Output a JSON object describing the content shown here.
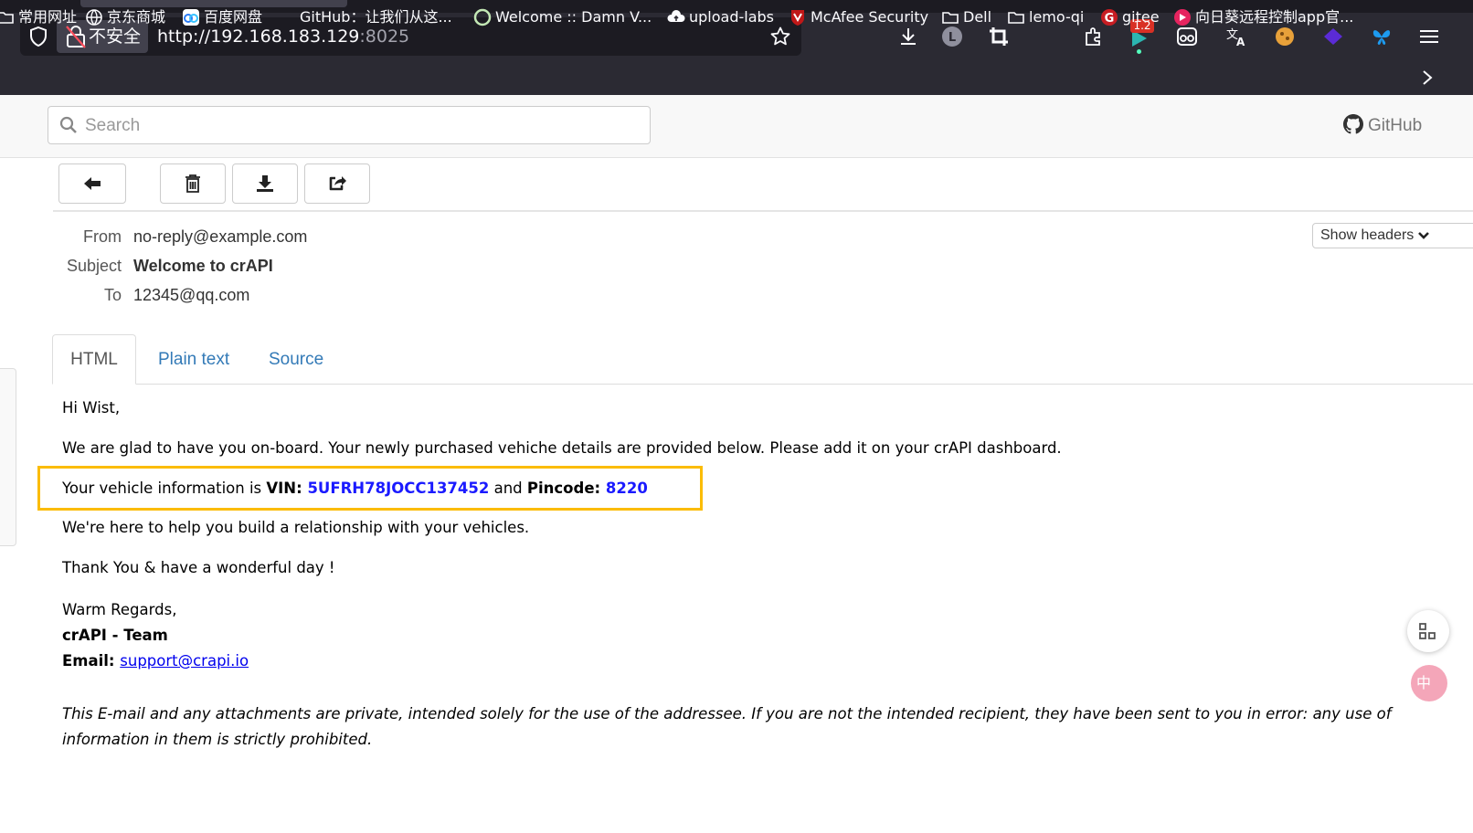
{
  "browser": {
    "security_label": "不安全",
    "url_main": "http://192.168.183.129",
    "url_port": ":8025",
    "badge_count": "1.2",
    "bookmarks": [
      "常用网址",
      "京东商城",
      "百度网盘",
      "GitHub：让我们从这...",
      "Welcome :: Damn V...",
      "upload-labs",
      "McAfee Security",
      "Dell",
      "lemo-qi",
      "gitee",
      "向日葵远程控制app官..."
    ],
    "ime_label": "中"
  },
  "app": {
    "search_placeholder": "Search",
    "github_label": "GitHub"
  },
  "message": {
    "from_label": "From",
    "from": "no-reply@example.com",
    "subject_label": "Subject",
    "subject": "Welcome to crAPI",
    "to_label": "To",
    "to": "12345@qq.com",
    "show_headers": "Show headers",
    "tabs": [
      "HTML",
      "Plain text",
      "Source"
    ]
  },
  "email_body": {
    "greeting": "Hi Wist,",
    "intro": "We are glad to have you on-board. Your newly purchased vehiche details are provided below. Please add it on your crAPI dashboard.",
    "vehicle_prefix": "Your vehicle information is ",
    "vin_label": "VIN: ",
    "vin": "5UFRH78JOCC137452",
    "and_text": " and ",
    "pincode_label": "Pincode: ",
    "pincode": "8220",
    "help": "We're here to help you build a relationship with your vehicles.",
    "thanks": "Thank You & have a wonderful day !",
    "regards": "Warm Regards,",
    "team": "crAPI - Team",
    "email_label": "Email: ",
    "support_email": "support@crapi.io",
    "disclaimer": "This E-mail and any attachments are private, intended solely for the use of the addressee. If you are not the intended recipient, they have been sent to you in error: any use of information in them is strictly prohibited."
  }
}
